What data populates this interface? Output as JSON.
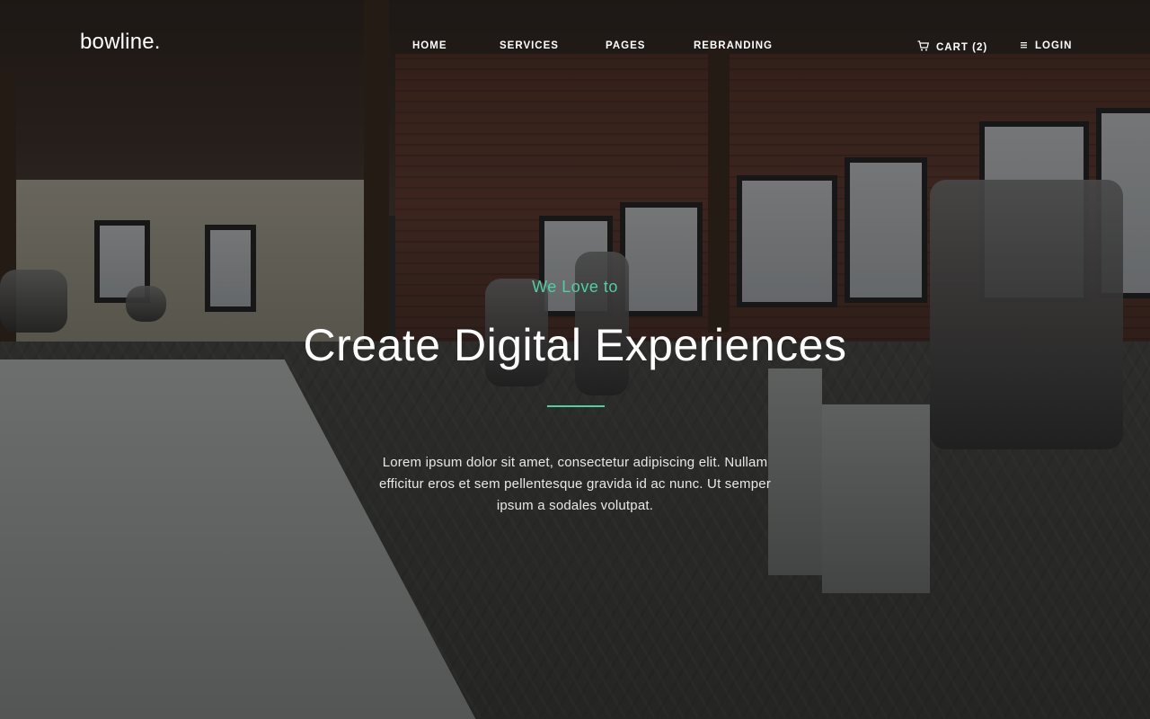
{
  "brand": {
    "logo": "bowline."
  },
  "nav": {
    "items": [
      {
        "label": "HOME"
      },
      {
        "label": "SERVICES"
      },
      {
        "label": "PAGES"
      },
      {
        "label": "REBRANDING"
      }
    ],
    "cart": {
      "label": "CART (2)",
      "icon": "cart-icon"
    },
    "login": {
      "label": "LOGIN",
      "icon": "menu-lines-icon"
    }
  },
  "hero": {
    "tagline": "We Love to",
    "headline": "Create Digital Experiences",
    "description": "Lorem ipsum dolor sit amet, consectetur adipiscing elit. Nullam efficitur eros et sem pellentesque gravida id ac nunc. Ut semper ipsum a sodales volutpat."
  },
  "colors": {
    "accent": "#4fcfa3",
    "text": "#ffffff",
    "overlay": "rgba(20,20,20,0.55)"
  }
}
